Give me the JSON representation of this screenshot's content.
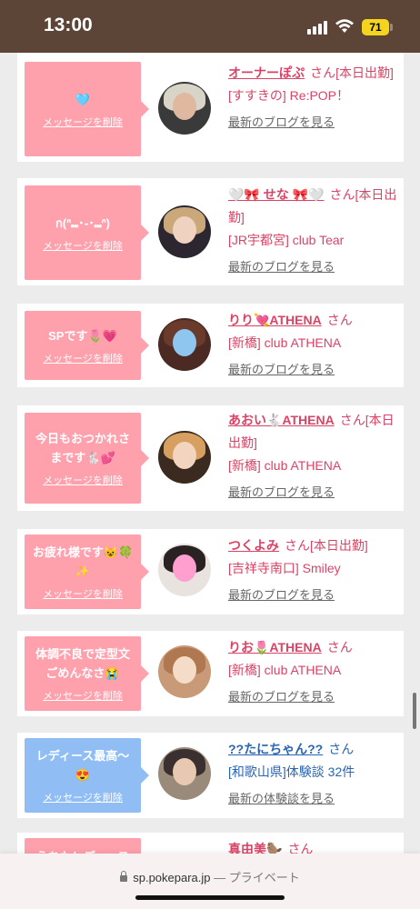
{
  "status_bar": {
    "time": "13:00",
    "battery": "71"
  },
  "messages": [
    {
      "bubble_text": "🩵",
      "delete_label": "メッセージを削除",
      "bubble_color": "#ffa0ad",
      "name": "オーナーぽぷ",
      "suffix": "さん[本日出勤]",
      "shop": "[すすきの] Re:POP！",
      "blog": "最新のブログを見る",
      "theme": "pink"
    },
    {
      "bubble_text": "ก(ᐢ⑉･֊･⑉ᐢ)",
      "delete_label": "メッセージを削除",
      "bubble_color": "#ffa0ad",
      "name": "🤍🎀 せな 🎀🤍",
      "suffix": "さん[本日出勤]",
      "shop": "[JR宇都宮] club Tear",
      "blog": "最新のブログを見る",
      "theme": "pink"
    },
    {
      "bubble_text": "SPです🌷💗",
      "delete_label": "メッセージを削除",
      "bubble_color": "#ffa0ad",
      "name": "りり💘ATHENA",
      "suffix": "さん",
      "shop": "[新橋] club ATHENA",
      "blog": "最新のブログを見る",
      "theme": "pink"
    },
    {
      "bubble_text": "今日もおつかれさまです🐇💕",
      "delete_label": "メッセージを削除",
      "bubble_color": "#ffa0ad",
      "name": "あおい🐇ATHENA",
      "suffix": "さん[本日出勤]",
      "shop": "[新橋] club ATHENA",
      "blog": "最新のブログを見る",
      "theme": "pink"
    },
    {
      "bubble_text": "お疲れ様です😺🍀✨",
      "delete_label": "メッセージを削除",
      "bubble_color": "#ffa0ad",
      "name": "つくよみ",
      "suffix": "さん[本日出勤]",
      "shop": "[吉祥寺南口] Smiley",
      "blog": "最新のブログを見る",
      "theme": "pink"
    },
    {
      "bubble_text": "体調不良で定型文ごめんなさ😭",
      "delete_label": "メッセージを削除",
      "bubble_color": "#ffa0ad",
      "name": "りお🌷ATHENA",
      "suffix": "さん",
      "shop": "[新橋] club ATHENA",
      "blog": "最新のブログを見る",
      "theme": "pink"
    },
    {
      "bubble_text": "レディース最高〜😍",
      "delete_label": "メッセージを削除",
      "bubble_color": "#8fbdf4",
      "name": "??たにちゃん??",
      "suffix": "さん",
      "shop": "[和歌山県]体験談 32件",
      "blog": "最新の体験談を見る",
      "theme": "blue"
    },
    {
      "bubble_text": "うちもレディース",
      "delete_label": "",
      "bubble_color": "#ffa0ad",
      "name": "真由美🦫",
      "suffix": "さん",
      "shop": "",
      "blog": "",
      "theme": "pink"
    }
  ],
  "browser": {
    "domain": "sp.pokepara.jp",
    "mode": "— プライベート"
  },
  "icons": {
    "signal": "cellular-signal-icon",
    "wifi": "wifi-icon",
    "battery": "battery-icon",
    "lock": "lock-icon"
  }
}
